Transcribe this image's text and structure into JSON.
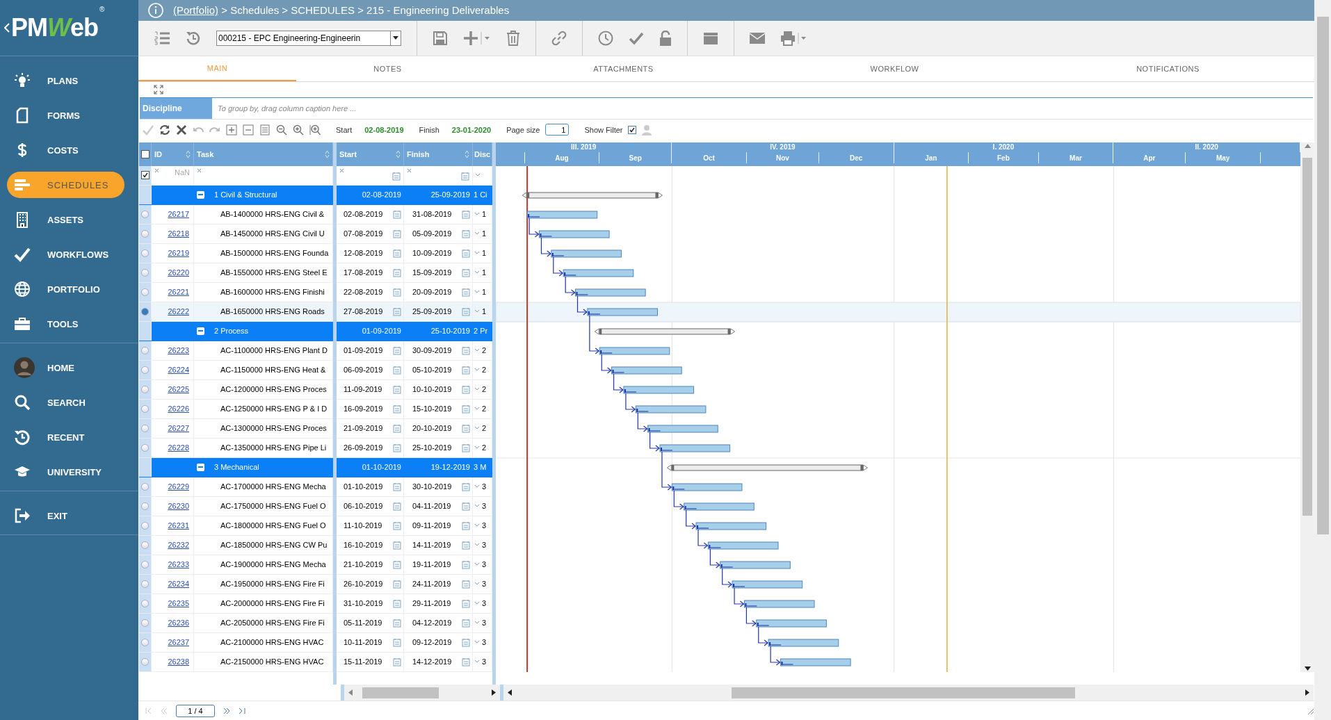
{
  "logo": {
    "prefix": "PM",
    "accent": "W",
    "suffix": "eb",
    "mark": "®"
  },
  "nav": [
    {
      "items": [
        {
          "label": "PLANS",
          "selected": false
        },
        {
          "label": "FORMS",
          "selected": false
        },
        {
          "label": "COSTS",
          "selected": false
        },
        {
          "label": "SCHEDULES",
          "selected": true
        },
        {
          "label": "ASSETS",
          "selected": false
        },
        {
          "label": "WORKFLOWS",
          "selected": false
        },
        {
          "label": "PORTFOLIO",
          "selected": false
        },
        {
          "label": "TOOLS",
          "selected": false
        }
      ]
    },
    {
      "items": [
        {
          "label": "HOME",
          "selected": false
        },
        {
          "label": "SEARCH",
          "selected": false
        },
        {
          "label": "RECENT",
          "selected": false
        },
        {
          "label": "UNIVERSITY",
          "selected": false
        }
      ]
    },
    {
      "items": [
        {
          "label": "EXIT",
          "selected": false
        }
      ]
    }
  ],
  "breadcrumb": {
    "link": "(Portfolio)",
    "rest": "> Schedules > SCHEDULES > 215 - Engineering Deliverables"
  },
  "record_select": {
    "value": "000215 - EPC Engineering-Engineerin"
  },
  "tabs": [
    {
      "label": "MAIN",
      "selected": true
    },
    {
      "label": "NOTES",
      "selected": false
    },
    {
      "label": "ATTACHMENTS",
      "selected": false
    },
    {
      "label": "WORKFLOW",
      "selected": false
    },
    {
      "label": "NOTIFICATIONS",
      "selected": false
    }
  ],
  "group_panel": {
    "chip": "Discipline",
    "placeholder": "To group by, drag column caption here ..."
  },
  "grid_toolbar": {
    "start_label": "Start",
    "start": "02-08-2019",
    "finish_label": "Finish",
    "finish": "23-01-2020",
    "page_size_label": "Page size",
    "page_size": "1",
    "show_filter_label": "Show Filter",
    "show_filter": true
  },
  "columns": [
    "ID",
    "Task",
    "Start",
    "Finish",
    "Disc"
  ],
  "filter": {
    "header_checked": false,
    "filter_checked": true,
    "id_placeholder": "NaN"
  },
  "rows": [
    {
      "kind": "group",
      "expanded": true,
      "task": "1 Civil & Structural",
      "start": "02-08-2019",
      "finish": "25-09-2019",
      "disc": "1 Ci"
    },
    {
      "kind": "task",
      "id": "26217",
      "task": "AB-1400000 HRS-ENG Civil &",
      "start": "02-08-2019",
      "finish": "31-08-2019",
      "disc": "1",
      "selected": false
    },
    {
      "kind": "task",
      "id": "26218",
      "task": "AB-1450000 HRS-ENG Civil U",
      "start": "07-08-2019",
      "finish": "05-09-2019",
      "disc": "1",
      "selected": false
    },
    {
      "kind": "task",
      "id": "26219",
      "task": "AB-1500000 HRS-ENG Founda",
      "start": "12-08-2019",
      "finish": "10-09-2019",
      "disc": "1",
      "selected": false
    },
    {
      "kind": "task",
      "id": "26220",
      "task": "AB-1550000 HRS-ENG Steel E",
      "start": "17-08-2019",
      "finish": "15-09-2019",
      "disc": "1",
      "selected": false
    },
    {
      "kind": "task",
      "id": "26221",
      "task": "AB-1600000 HRS-ENG Finishi",
      "start": "22-08-2019",
      "finish": "20-09-2019",
      "disc": "1",
      "selected": false
    },
    {
      "kind": "task",
      "id": "26222",
      "task": "AB-1650000 HRS-ENG Roads",
      "start": "27-08-2019",
      "finish": "25-09-2019",
      "disc": "1",
      "selected": true
    },
    {
      "kind": "group",
      "expanded": true,
      "task": "2 Process",
      "start": "01-09-2019",
      "finish": "25-10-2019",
      "disc": "2 Pr"
    },
    {
      "kind": "task",
      "id": "26223",
      "task": "AC-1100000 HRS-ENG Plant D",
      "start": "01-09-2019",
      "finish": "30-09-2019",
      "disc": "2",
      "selected": false
    },
    {
      "kind": "task",
      "id": "26224",
      "task": "AC-1150000 HRS-ENG Heat &",
      "start": "06-09-2019",
      "finish": "05-10-2019",
      "disc": "2",
      "selected": false
    },
    {
      "kind": "task",
      "id": "26225",
      "task": "AC-1200000 HRS-ENG Proces",
      "start": "11-09-2019",
      "finish": "10-10-2019",
      "disc": "2",
      "selected": false
    },
    {
      "kind": "task",
      "id": "26226",
      "task": "AC-1250000 HRS-ENG P & I D",
      "start": "16-09-2019",
      "finish": "15-10-2019",
      "disc": "2",
      "selected": false
    },
    {
      "kind": "task",
      "id": "26227",
      "task": "AC-1300000 HRS-ENG Proces",
      "start": "21-09-2019",
      "finish": "20-10-2019",
      "disc": "2",
      "selected": false
    },
    {
      "kind": "task",
      "id": "26228",
      "task": "AC-1350000 HRS-ENG Pipe Li",
      "start": "26-09-2019",
      "finish": "25-10-2019",
      "disc": "2",
      "selected": false
    },
    {
      "kind": "group",
      "expanded": true,
      "task": "3 Mechanical",
      "start": "01-10-2019",
      "finish": "19-12-2019",
      "disc": "3 M"
    },
    {
      "kind": "task",
      "id": "26229",
      "task": "AC-1700000 HRS-ENG Mecha",
      "start": "01-10-2019",
      "finish": "30-10-2019",
      "disc": "3",
      "selected": false
    },
    {
      "kind": "task",
      "id": "26230",
      "task": "AC-1750000 HRS-ENG Fuel O",
      "start": "06-10-2019",
      "finish": "04-11-2019",
      "disc": "3",
      "selected": false
    },
    {
      "kind": "task",
      "id": "26231",
      "task": "AC-1800000 HRS-ENG Fuel O",
      "start": "11-10-2019",
      "finish": "09-11-2019",
      "disc": "3",
      "selected": false
    },
    {
      "kind": "task",
      "id": "26232",
      "task": "AC-1850000 HRS-ENG CW Pu",
      "start": "16-10-2019",
      "finish": "14-11-2019",
      "disc": "3",
      "selected": false
    },
    {
      "kind": "task",
      "id": "26233",
      "task": "AC-1900000 HRS-ENG Mecha",
      "start": "21-10-2019",
      "finish": "19-11-2019",
      "disc": "3",
      "selected": false
    },
    {
      "kind": "task",
      "id": "26234",
      "task": "AC-1950000 HRS-ENG Fire Fi",
      "start": "26-10-2019",
      "finish": "24-11-2019",
      "disc": "3",
      "selected": false
    },
    {
      "kind": "task",
      "id": "26235",
      "task": "AC-2000000 HRS-ENG Fire Fi",
      "start": "31-10-2019",
      "finish": "29-11-2019",
      "disc": "3",
      "selected": false
    },
    {
      "kind": "task",
      "id": "26236",
      "task": "AC-2050000 HRS-ENG Fire Fi",
      "start": "05-11-2019",
      "finish": "04-12-2019",
      "disc": "3",
      "selected": false
    },
    {
      "kind": "task",
      "id": "26237",
      "task": "AC-2100000 HRS-ENG HVAC",
      "start": "10-11-2019",
      "finish": "09-12-2019",
      "disc": "3",
      "selected": false
    },
    {
      "kind": "task",
      "id": "26238",
      "task": "AC-2150000 HRS-ENG HVAC",
      "start": "15-11-2019",
      "finish": "14-12-2019",
      "disc": "3",
      "selected": false
    }
  ],
  "timeline": {
    "quarters": [
      "III. 2019",
      "IV. 2019",
      "I. 2020",
      "II. 2020"
    ],
    "months": [
      "Aug",
      "Sep",
      "Oct",
      "Nov",
      "Dec",
      "Jan",
      "Feb",
      "Mar",
      "Apr",
      "May"
    ]
  },
  "pager": {
    "page": "1 / 4"
  }
}
